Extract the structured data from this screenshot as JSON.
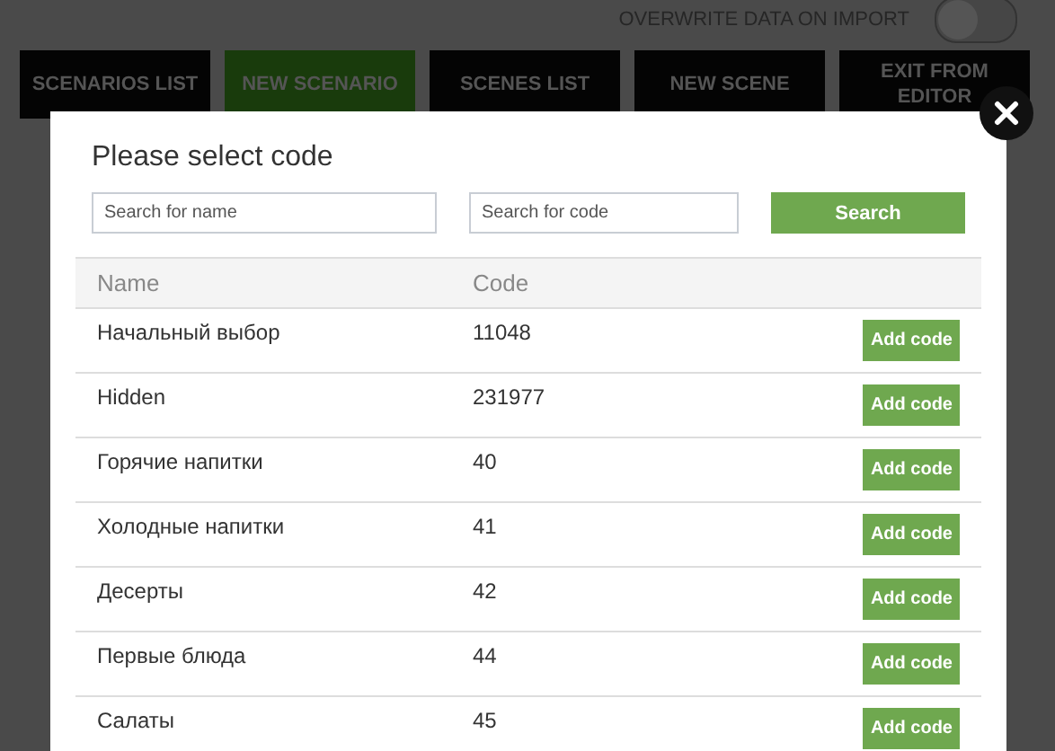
{
  "import_option": {
    "label": "OVERWRITE DATA ON IMPORT",
    "on": false
  },
  "nav": [
    {
      "label": "SCENARIOS LIST",
      "selected": false
    },
    {
      "label": "NEW SCENARIO",
      "selected": true
    },
    {
      "label": "SCENES LIST",
      "selected": false
    },
    {
      "label": "NEW SCENE",
      "selected": false
    },
    {
      "label": "EXIT FROM EDITOR",
      "selected": false
    }
  ],
  "dialog": {
    "title": "Please select code",
    "name_search": {
      "placeholder": "Search for name"
    },
    "code_search": {
      "placeholder": "Search for code"
    },
    "search_button": "Search",
    "table": {
      "columns": [
        "Name",
        "Code"
      ],
      "rows": [
        {
          "name": "Начальный выбор",
          "code": "11048",
          "action": "Add code"
        },
        {
          "name": "Hidden",
          "code": "231977",
          "action": "Add code"
        },
        {
          "name": "Горячие напитки",
          "code": "40",
          "action": "Add code"
        },
        {
          "name": "Холодные напитки",
          "code": "41",
          "action": "Add code"
        },
        {
          "name": "Десерты",
          "code": "42",
          "action": "Add code"
        },
        {
          "name": "Первые блюда",
          "code": "44",
          "action": "Add code"
        },
        {
          "name": "Салаты",
          "code": "45",
          "action": "Add code"
        }
      ]
    }
  }
}
